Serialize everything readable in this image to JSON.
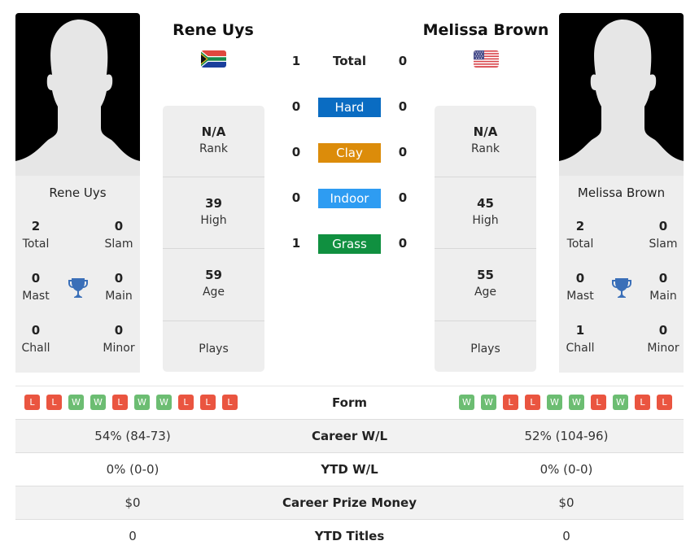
{
  "player1": {
    "name": "Rene Uys",
    "country": "South Africa",
    "flag_icon": "south-africa-flag",
    "titles": {
      "total": {
        "value": "2",
        "label": "Total"
      },
      "slam": {
        "value": "0",
        "label": "Slam"
      },
      "mast": {
        "value": "0",
        "label": "Mast"
      },
      "main": {
        "value": "0",
        "label": "Main"
      },
      "chall": {
        "value": "0",
        "label": "Chall"
      },
      "minor": {
        "value": "0",
        "label": "Minor"
      }
    },
    "rank": {
      "value": "N/A",
      "label": "Rank"
    },
    "high": {
      "value": "39",
      "label": "High"
    },
    "age": {
      "value": "59",
      "label": "Age"
    },
    "plays": {
      "value": "",
      "label": "Plays"
    },
    "form": [
      "L",
      "L",
      "W",
      "W",
      "L",
      "W",
      "W",
      "L",
      "L",
      "L"
    ]
  },
  "player2": {
    "name": "Melissa Brown",
    "country": "United States",
    "flag_icon": "usa-flag",
    "titles": {
      "total": {
        "value": "2",
        "label": "Total"
      },
      "slam": {
        "value": "0",
        "label": "Slam"
      },
      "mast": {
        "value": "0",
        "label": "Mast"
      },
      "main": {
        "value": "0",
        "label": "Main"
      },
      "chall": {
        "value": "1",
        "label": "Chall"
      },
      "minor": {
        "value": "0",
        "label": "Minor"
      }
    },
    "rank": {
      "value": "N/A",
      "label": "Rank"
    },
    "high": {
      "value": "45",
      "label": "High"
    },
    "age": {
      "value": "55",
      "label": "Age"
    },
    "plays": {
      "value": "",
      "label": "Plays"
    },
    "form": [
      "W",
      "W",
      "L",
      "L",
      "W",
      "W",
      "L",
      "W",
      "L",
      "L"
    ]
  },
  "h2h": [
    {
      "label": "Total",
      "p1": "1",
      "p2": "0",
      "color": null
    },
    {
      "label": "Hard",
      "p1": "0",
      "p2": "0",
      "color": "#0a6cc2"
    },
    {
      "label": "Clay",
      "p1": "0",
      "p2": "0",
      "color": "#dc8c0a"
    },
    {
      "label": "Indoor",
      "p1": "0",
      "p2": "0",
      "color": "#2e9cf2"
    },
    {
      "label": "Grass",
      "p1": "1",
      "p2": "0",
      "color": "#109040"
    }
  ],
  "comparison": {
    "form_label": "Form",
    "rows": [
      {
        "label": "Career W/L",
        "p1": "54% (84-73)",
        "p2": "52% (104-96)"
      },
      {
        "label": "YTD W/L",
        "p1": "0% (0-0)",
        "p2": "0% (0-0)"
      },
      {
        "label": "Career Prize Money",
        "p1": "$0",
        "p2": "$0"
      },
      {
        "label": "YTD Titles",
        "p1": "0",
        "p2": "0"
      }
    ]
  },
  "colors": {
    "win": "#6cbd72",
    "loss": "#ea5540",
    "trophy": "#3a6fb8"
  }
}
